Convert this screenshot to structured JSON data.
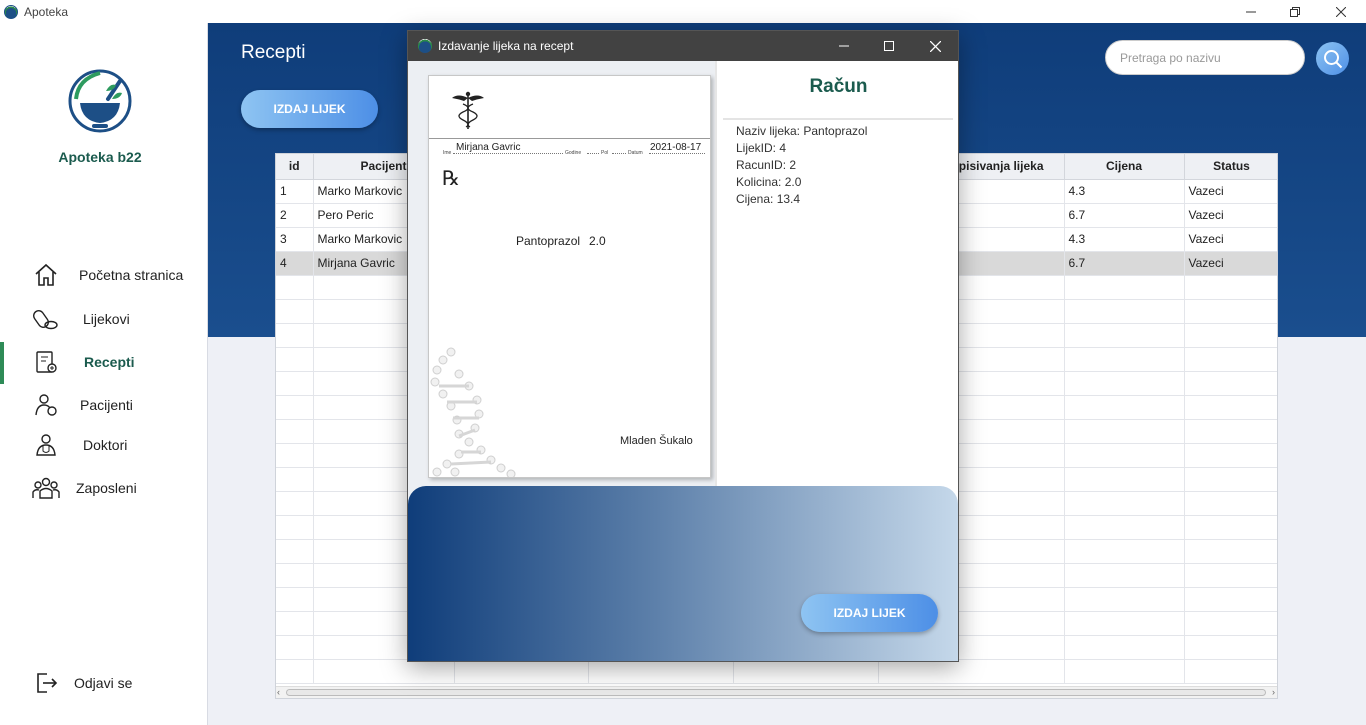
{
  "window": {
    "title": "Apoteka"
  },
  "sidebar": {
    "brand": "Apoteka b22",
    "items": [
      {
        "label": "Početna stranica",
        "icon": "home-icon"
      },
      {
        "label": "Lijekovi",
        "icon": "pills-icon"
      },
      {
        "label": "Recepti",
        "icon": "prescription-icon"
      },
      {
        "label": "Pacijenti",
        "icon": "patient-icon"
      },
      {
        "label": "Doktori",
        "icon": "doctor-icon"
      },
      {
        "label": "Zaposleni",
        "icon": "staff-icon"
      }
    ],
    "active": "Recepti",
    "logout": "Odjavi se"
  },
  "header": {
    "title": "Recepti",
    "issue_button": "IZDAJ LIJEK",
    "search_placeholder": "Pretraga po nazivu"
  },
  "table": {
    "columns": [
      "id",
      "Pacijent",
      "",
      "",
      "",
      "opisivanja lijeka",
      "Cijena",
      "Status"
    ],
    "rows": [
      {
        "id": "1",
        "pacijent": "Marko Markovic",
        "cijena": "4.3",
        "status": "Vazeci"
      },
      {
        "id": "2",
        "pacijent": "Pero Peric",
        "cijena": "6.7",
        "status": "Vazeci"
      },
      {
        "id": "3",
        "pacijent": "Marko Markovic",
        "cijena": "4.3",
        "status": "Vazeci"
      },
      {
        "id": "4",
        "pacijent": "Mirjana Gavric",
        "cijena": "6.7",
        "status": "Vazeci"
      }
    ],
    "selected_row": 4
  },
  "dialog": {
    "title": "Izdavanje lijeka na recept",
    "prescription": {
      "patient_name": "Mirjana Gavric",
      "date": "2021-08-17",
      "label_ime": "Ime",
      "label_godine": "Godine",
      "label_pol": "Pol",
      "label_datum": "Datum",
      "rx_symbol": "℞",
      "medicine": "Pantoprazol",
      "quantity": "2.0",
      "doctor": "Mladen Šukalo"
    },
    "bill": {
      "title": "Račun",
      "lines": [
        "Naziv lijeka: Pantoprazol",
        "LijekID: 4",
        "RacunID: 2",
        "Kolicina: 2.0",
        "Cijena: 13.4"
      ]
    },
    "issue_button": "IZDAJ LIJEK"
  }
}
